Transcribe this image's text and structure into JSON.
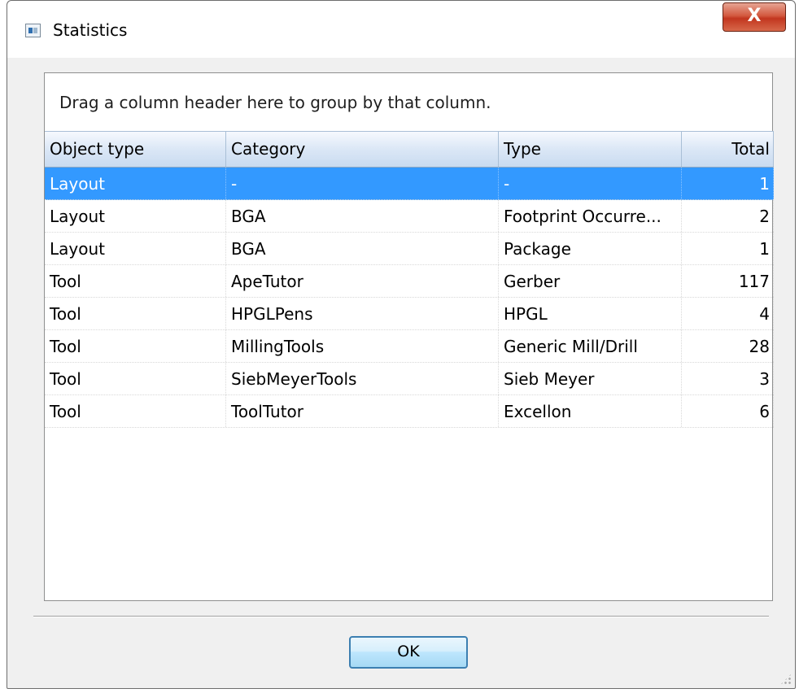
{
  "window": {
    "title": "Statistics",
    "close_glyph": "X"
  },
  "grid": {
    "group_hint": "Drag a column header here to group by that column.",
    "columns": [
      "Object type",
      "Category",
      "Type",
      "Total"
    ],
    "rows": [
      {
        "object_type": "Layout",
        "category": "-",
        "type": "-",
        "total": "1",
        "selected": true
      },
      {
        "object_type": "Layout",
        "category": "BGA",
        "type": "Footprint Occurre...",
        "total": "2"
      },
      {
        "object_type": "Layout",
        "category": "BGA",
        "type": "Package",
        "total": "1"
      },
      {
        "object_type": "Tool",
        "category": "ApeTutor",
        "type": "Gerber",
        "total": "117"
      },
      {
        "object_type": "Tool",
        "category": "HPGLPens",
        "type": "HPGL",
        "total": "4"
      },
      {
        "object_type": "Tool",
        "category": "MillingTools",
        "type": "Generic Mill/Drill",
        "total": "28"
      },
      {
        "object_type": "Tool",
        "category": "SiebMeyerTools",
        "type": "Sieb Meyer",
        "total": "3"
      },
      {
        "object_type": "Tool",
        "category": "ToolTutor",
        "type": "Excellon",
        "total": "6"
      }
    ]
  },
  "footer": {
    "ok_label": "OK"
  },
  "icons": {
    "app": "statistics-app-icon",
    "close": "close-icon",
    "grip": "resize-grip-icon"
  },
  "colors": {
    "selection": "#3399ff",
    "close_button": "#c2361f",
    "header_gradient": "#c9dbf0"
  }
}
